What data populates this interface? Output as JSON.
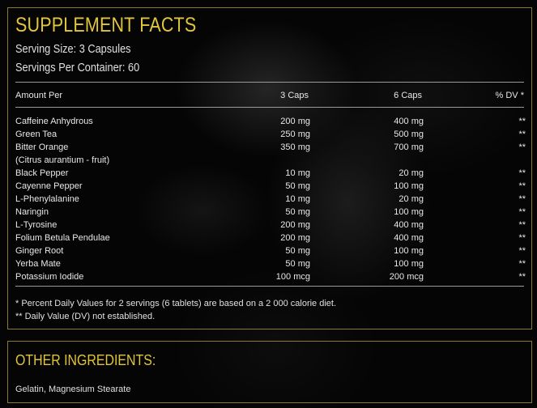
{
  "facts": {
    "title": "SUPPLEMENT FACTS",
    "serving_size": "Serving Size: 3 Capsules",
    "servings_per_container": "Servings Per Container: 60",
    "columns": {
      "name": "Amount Per",
      "three": "3 Caps",
      "six": "6 Caps",
      "dv": "% DV *"
    },
    "rows": [
      {
        "name": "Caffeine Anhydrous",
        "three": "200 mg",
        "six": "400 mg",
        "dv": "**"
      },
      {
        "name": "Green Tea",
        "three": "250 mg",
        "six": "500 mg",
        "dv": "**"
      },
      {
        "name": "Bitter Orange",
        "three": "350 mg",
        "six": "700 mg",
        "dv": "**"
      },
      {
        "name": "(Citrus aurantium - fruit)",
        "three": "",
        "six": "",
        "dv": ""
      },
      {
        "name": "Black Pepper",
        "three": "10 mg",
        "six": "20 mg",
        "dv": "**"
      },
      {
        "name": "Cayenne Pepper",
        "three": "50 mg",
        "six": "100 mg",
        "dv": "**"
      },
      {
        "name": "L-Phenylalanine",
        "three": "10 mg",
        "six": "20 mg",
        "dv": "**"
      },
      {
        "name": "Naringin",
        "three": "50 mg",
        "six": "100 mg",
        "dv": "**"
      },
      {
        "name": "L-Tyrosine",
        "three": "200 mg",
        "six": "400 mg",
        "dv": "**"
      },
      {
        "name": "Folium Betula Pendulae",
        "three": "200 mg",
        "six": "400 mg",
        "dv": "**"
      },
      {
        "name": "Ginger Root",
        "three": "50 mg",
        "six": "100 mg",
        "dv": "**"
      },
      {
        "name": "Yerba Mate",
        "three": "50 mg",
        "six": "100 mg",
        "dv": "**"
      },
      {
        "name": "Potassium Iodide",
        "three": "100 mcg",
        "six": "200 mcg",
        "dv": "**"
      }
    ],
    "note_daily_values": "* Percent Daily Values for 2 servings (6 tablets) are based on a 2 000 calorie diet.",
    "note_not_established": "** Daily Value (DV) not established."
  },
  "other": {
    "title": "OTHER INGREDIENTS:",
    "text": "Gelatin, Magnesium Stearate"
  }
}
